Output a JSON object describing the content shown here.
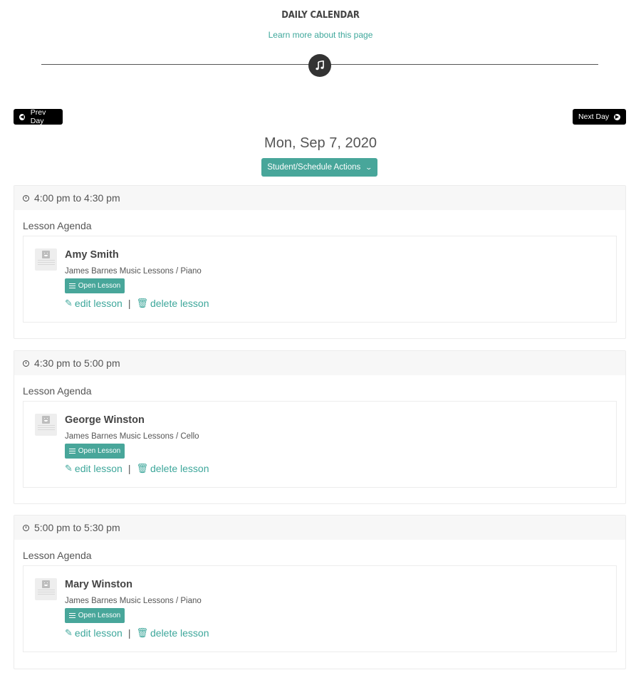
{
  "header": {
    "title": "DAILY CALENDAR",
    "learn_more_link": "Learn more about this page",
    "badge_icon": "music-note-icon"
  },
  "nav": {
    "prev_label": "Prev Day",
    "next_label": "Next Day"
  },
  "date": "Mon, Sep 7, 2020",
  "actions_button": "Student/Schedule Actions",
  "slots": [
    {
      "time": "4:00 pm to 4:30 pm",
      "agenda_label": "Lesson Agenda",
      "student": "Amy Smith",
      "course": "James Barnes Music Lessons / Piano",
      "open_label": "Open Lesson",
      "edit_label": "edit lesson",
      "separator": "|",
      "delete_label": "delete lesson"
    },
    {
      "time": "4:30 pm to 5:00 pm",
      "agenda_label": "Lesson Agenda",
      "student": "George Winston",
      "course": "James Barnes Music Lessons / Cello",
      "open_label": "Open Lesson",
      "edit_label": "edit lesson",
      "separator": "|",
      "delete_label": "delete lesson"
    },
    {
      "time": "5:00 pm to 5:30 pm",
      "agenda_label": "Lesson Agenda",
      "student": "Mary Winston",
      "course": "James Barnes Music Lessons / Piano",
      "open_label": "Open Lesson",
      "edit_label": "edit lesson",
      "separator": "|",
      "delete_label": "delete lesson"
    }
  ],
  "colors": {
    "accent": "#48a69a",
    "link": "#3ea79b",
    "nav_button": "#000000",
    "header_bg": "#f7f7f7"
  }
}
